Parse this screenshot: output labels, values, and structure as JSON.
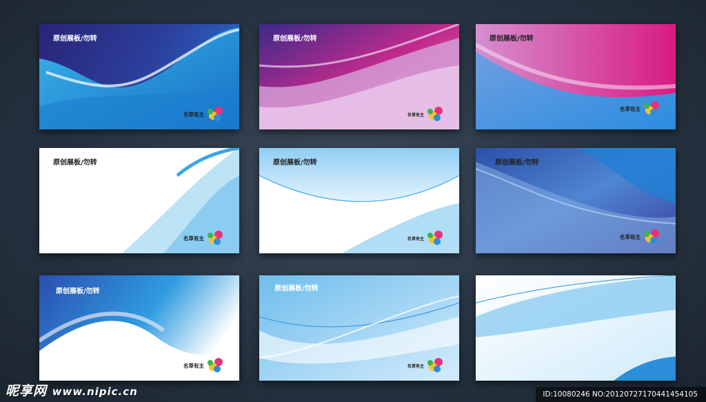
{
  "cards": [
    {
      "title": "原创展板/勿转",
      "brand": "名草有主"
    },
    {
      "title": "原创展板/勿转",
      "brand": "名草有主"
    },
    {
      "title": "原创展板/勿转",
      "brand": "名草有主"
    },
    {
      "title": "原创展板/勿转",
      "brand": "名草有主"
    },
    {
      "title": "原创展板/勿转",
      "brand": "名草有主"
    },
    {
      "title": "原创展板/勿转",
      "brand": "名草有主"
    },
    {
      "title": "原创展板/勿转",
      "brand": "名草有主"
    },
    {
      "title": "原创展板/勿转",
      "brand": "名草有主"
    },
    {
      "title": "",
      "brand": ""
    }
  ],
  "watermark": {
    "logo": "昵享网",
    "site": "www.nipic.cn",
    "id_text": "ID:10080246 NO:20120727170441454105"
  },
  "colors": {
    "deep_blue": "#2a2a86",
    "sky_blue": "#2fa4e0",
    "magenta": "#c81e8c",
    "light_blue": "#bfe3f7",
    "page_bg": "#263341"
  },
  "icons": [
    "brand-logo-icon"
  ]
}
